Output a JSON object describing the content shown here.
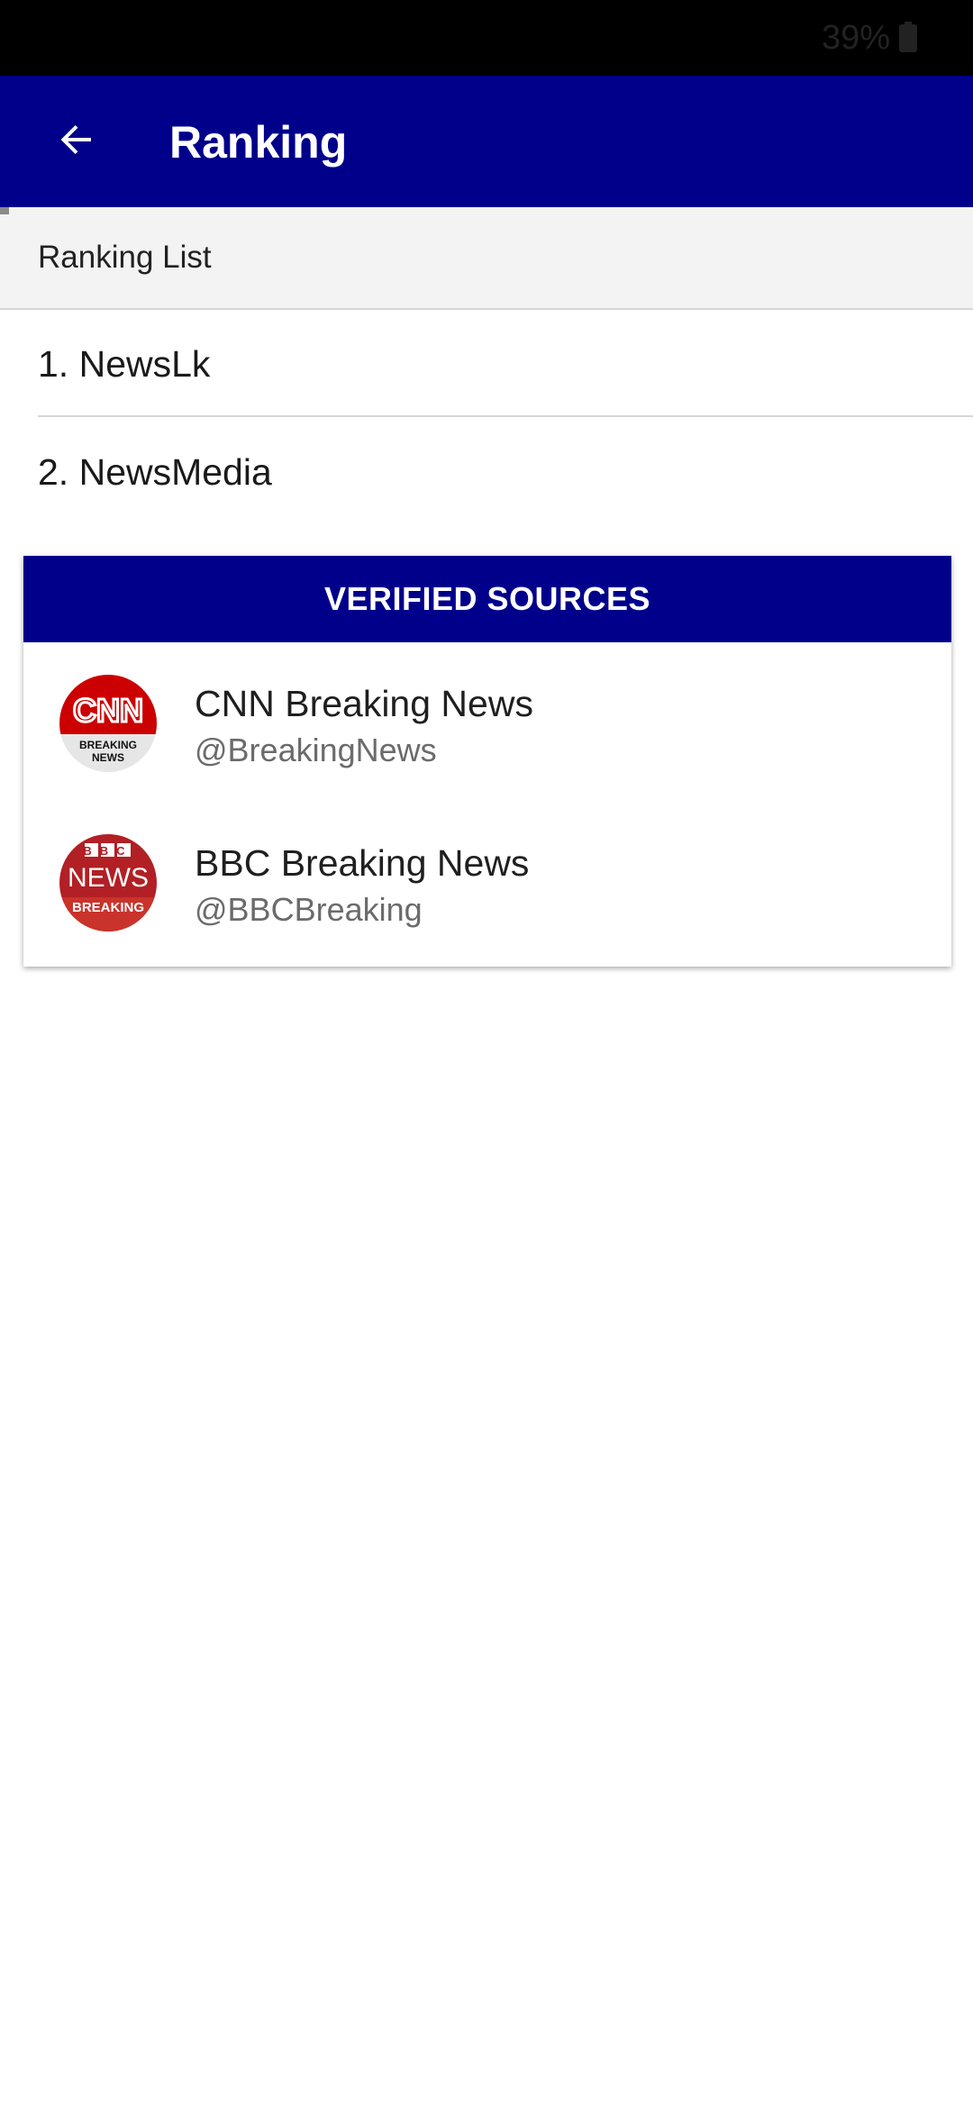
{
  "status_bar": {
    "battery_percent": "39%",
    "battery_icon": "battery-icon"
  },
  "app_bar": {
    "back_icon": "arrow-left-icon",
    "title": "Ranking"
  },
  "tabs": [
    {
      "label": "Ranking List",
      "selected": true
    }
  ],
  "ranking": {
    "items": [
      {
        "label": "1. NewsLk"
      },
      {
        "label": "2. NewsMedia"
      }
    ]
  },
  "verified": {
    "header": "VERIFIED SOURCES",
    "sources": [
      {
        "name": "CNN Breaking News",
        "handle": "@BreakingNews",
        "logo": "cnn-logo-icon",
        "logo_text": "CNN",
        "logo_subtext_1": "BREAKING",
        "logo_subtext_2": "NEWS"
      },
      {
        "name": "BBC Breaking News",
        "handle": "@BBCBreaking",
        "logo": "bbc-logo-icon",
        "logo_text": "BBC",
        "logo_mid_text": "NEWS",
        "logo_subtext": "BREAKING"
      }
    ]
  },
  "colors": {
    "primary": "#00008b",
    "status_bar": "#000000",
    "tab_background": "#f3f3f3",
    "cnn_red": "#cc0000",
    "bbc_red": "#b21f24"
  }
}
